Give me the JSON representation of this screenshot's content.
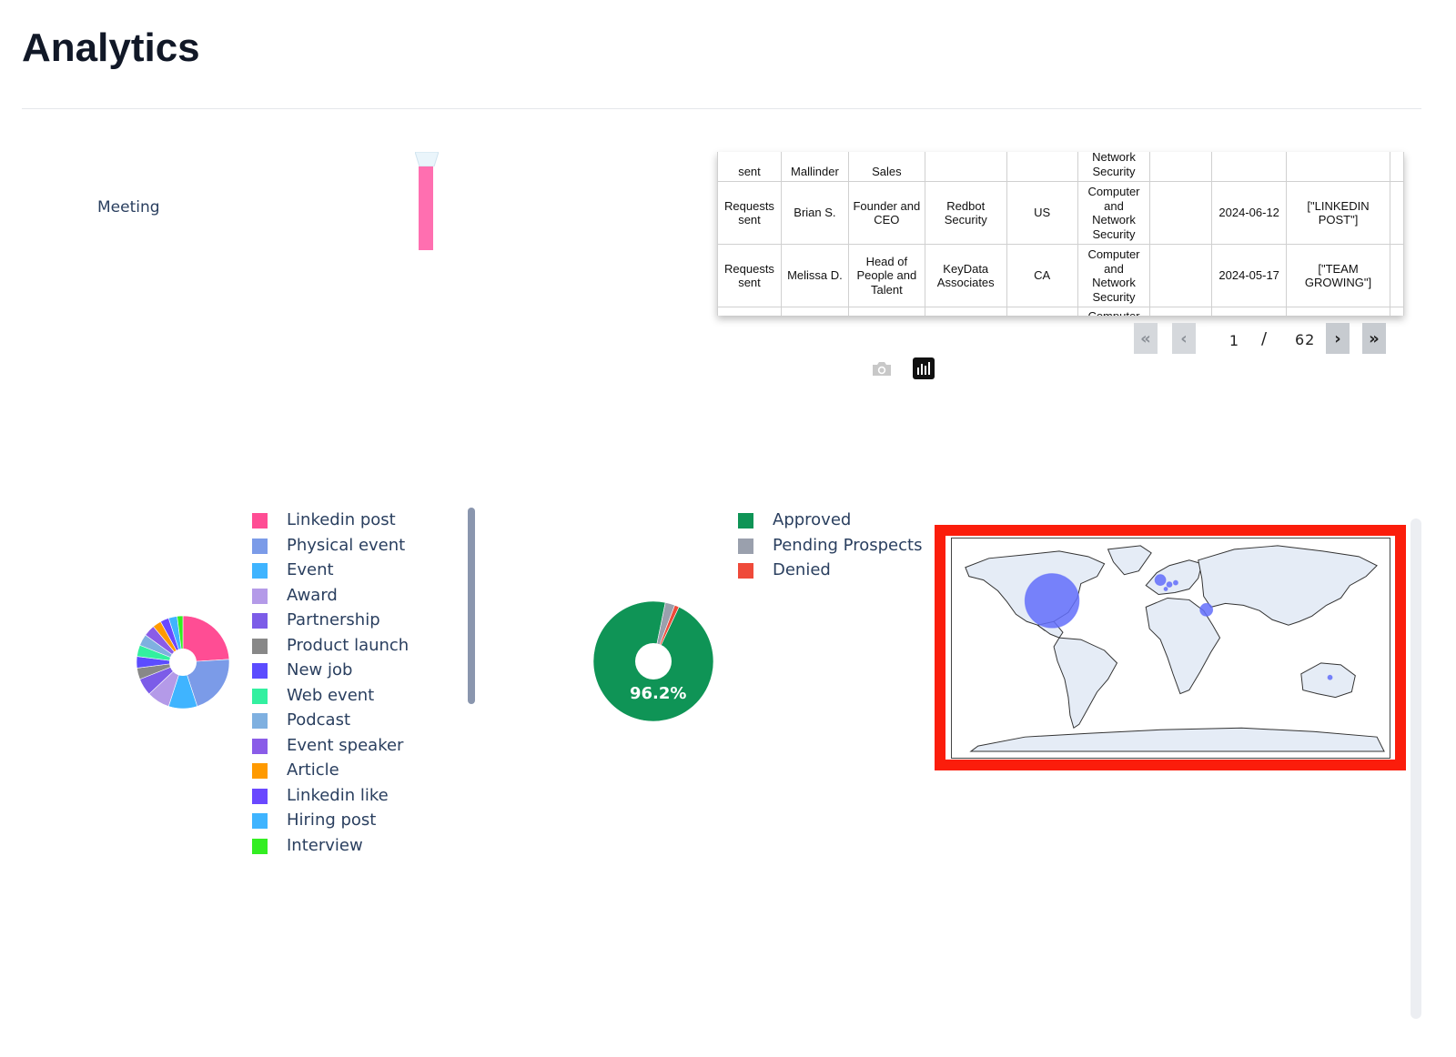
{
  "page": {
    "title": "Analytics"
  },
  "funnel": {
    "stage_label": "Meeting",
    "bar_color": "#ff6fb0"
  },
  "table": {
    "rows": [
      [
        "sent",
        "Mallinder",
        "Sales",
        "",
        "",
        "Network\nSecurity",
        "",
        "",
        ""
      ],
      [
        "Requests\nsent",
        "Brian S.",
        "Founder and\nCEO",
        "Redbot\nSecurity",
        "US",
        "Computer\nand\nNetwork\nSecurity",
        "",
        "2024-06-12",
        "[\"LINKEDIN\nPOST\"]"
      ],
      [
        "Requests\nsent",
        "Melissa D.",
        "Head of\nPeople and\nTalent",
        "KeyData\nAssociates",
        "CA",
        "Computer\nand\nNetwork\nSecurity",
        "",
        "2024-05-17",
        "[\"TEAM\nGROWING\"]"
      ],
      [
        "",
        "",
        "",
        "",
        "",
        "Computer",
        "",
        "",
        ""
      ]
    ]
  },
  "pagination": {
    "current_page": "1",
    "separator": "/",
    "total_pages": "62"
  },
  "toolbar": {
    "camera_icon": "camera-icon",
    "chart_icon": "bar-chart-icon"
  },
  "sources_legend": [
    {
      "label": "Linkedin post",
      "color": "#ff4d94"
    },
    {
      "label": "Physical event",
      "color": "#7b9be8"
    },
    {
      "label": "Event",
      "color": "#3fb4ff"
    },
    {
      "label": "Award",
      "color": "#b49ae8"
    },
    {
      "label": "Partnership",
      "color": "#7c5ce8"
    },
    {
      "label": "Product launch",
      "color": "#888888"
    },
    {
      "label": "New job",
      "color": "#5b4cff"
    },
    {
      "label": "Web event",
      "color": "#33f0a0"
    },
    {
      "label": "Podcast",
      "color": "#7fb0e0"
    },
    {
      "label": "Event speaker",
      "color": "#8a5ce8"
    },
    {
      "label": "Article",
      "color": "#ff9a00"
    },
    {
      "label": "Linkedin like",
      "color": "#6a48ff"
    },
    {
      "label": "Hiring post",
      "color": "#3fb4ff"
    },
    {
      "label": "Interview",
      "color": "#33ee22"
    }
  ],
  "status_legend": [
    {
      "label": "Approved",
      "color": "#0f9456"
    },
    {
      "label": "Pending Prospects",
      "color": "#9aa0ad"
    },
    {
      "label": "Denied",
      "color": "#ef4a3a"
    }
  ],
  "chart_data": [
    {
      "type": "pie",
      "hole": true,
      "categories": [
        "Linkedin post",
        "Physical event",
        "Event",
        "Award",
        "Partnership",
        "Product launch",
        "New job",
        "Web event",
        "Podcast",
        "Event speaker",
        "Article",
        "Linkedin like",
        "Hiring post",
        "Interview"
      ],
      "values": [
        24,
        21,
        10,
        8,
        6,
        4,
        4,
        4,
        4,
        4,
        3,
        3,
        3,
        2
      ]
    },
    {
      "type": "pie",
      "hole": true,
      "categories": [
        "Approved",
        "Pending Prospects",
        "Denied"
      ],
      "values": [
        96.2,
        2.6,
        1.2
      ],
      "labels": [
        "96.2%",
        "",
        ""
      ]
    }
  ],
  "map": {
    "border_color": "#fb1d0b",
    "land_color": "#e5ecf6",
    "bubble_color": "#636efa"
  }
}
